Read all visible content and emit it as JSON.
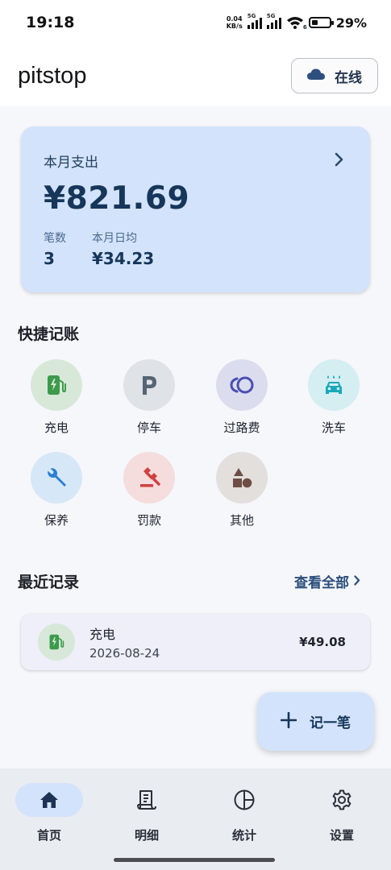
{
  "status_bar": {
    "time": "19:18",
    "net_speed_value": "0.04",
    "net_speed_unit": "KB/s",
    "signal1_label": "5G",
    "signal2_label": "5G",
    "wifi_badge": "6",
    "battery_percent": "29%"
  },
  "header": {
    "app_title": "pitstop",
    "online_label": "在线",
    "online_icon": "cloud-icon"
  },
  "summary": {
    "label": "本月支出",
    "amount": "¥821.69",
    "count_label": "笔数",
    "count_value": "3",
    "daily_avg_label": "本月日均",
    "daily_avg_value": "¥34.23"
  },
  "quick": {
    "title": "快捷记账",
    "items": [
      {
        "label": "充电",
        "icon": "ev-charging-icon",
        "bg": "#d7e8d9",
        "fg": "#3c9a4a"
      },
      {
        "label": "停车",
        "icon": "parking-icon",
        "bg": "#dfe2e6",
        "fg": "#566574"
      },
      {
        "label": "过路费",
        "icon": "toll-icon",
        "bg": "#dcdcef",
        "fg": "#4a4fb0"
      },
      {
        "label": "洗车",
        "icon": "car-wash-icon",
        "bg": "#d4eef2",
        "fg": "#1aa8b8"
      },
      {
        "label": "保养",
        "icon": "wrench-icon",
        "bg": "#d6e7f7",
        "fg": "#2a7fd0"
      },
      {
        "label": "罚款",
        "icon": "gavel-icon",
        "bg": "#f5dcdd",
        "fg": "#d14040"
      },
      {
        "label": "其他",
        "icon": "shapes-icon",
        "bg": "#e3dfdd",
        "fg": "#6e4e44"
      }
    ]
  },
  "recent": {
    "title": "最近记录",
    "view_all": "查看全部",
    "records": [
      {
        "title": "充电",
        "date": "2026-08-24",
        "amount": "¥49.08",
        "icon": "ev-charging-icon"
      }
    ]
  },
  "fab": {
    "label": "记一笔",
    "icon": "plus-icon"
  },
  "nav": {
    "items": [
      {
        "label": "首页",
        "icon": "home-icon",
        "active": true
      },
      {
        "label": "明细",
        "icon": "receipt-icon",
        "active": false
      },
      {
        "label": "统计",
        "icon": "pie-chart-icon",
        "active": false
      },
      {
        "label": "设置",
        "icon": "gear-icon",
        "active": false
      }
    ]
  },
  "colors": {
    "accent": "#d3e3fb",
    "accent_text": "#16365a",
    "background": "#f5f7fa"
  }
}
